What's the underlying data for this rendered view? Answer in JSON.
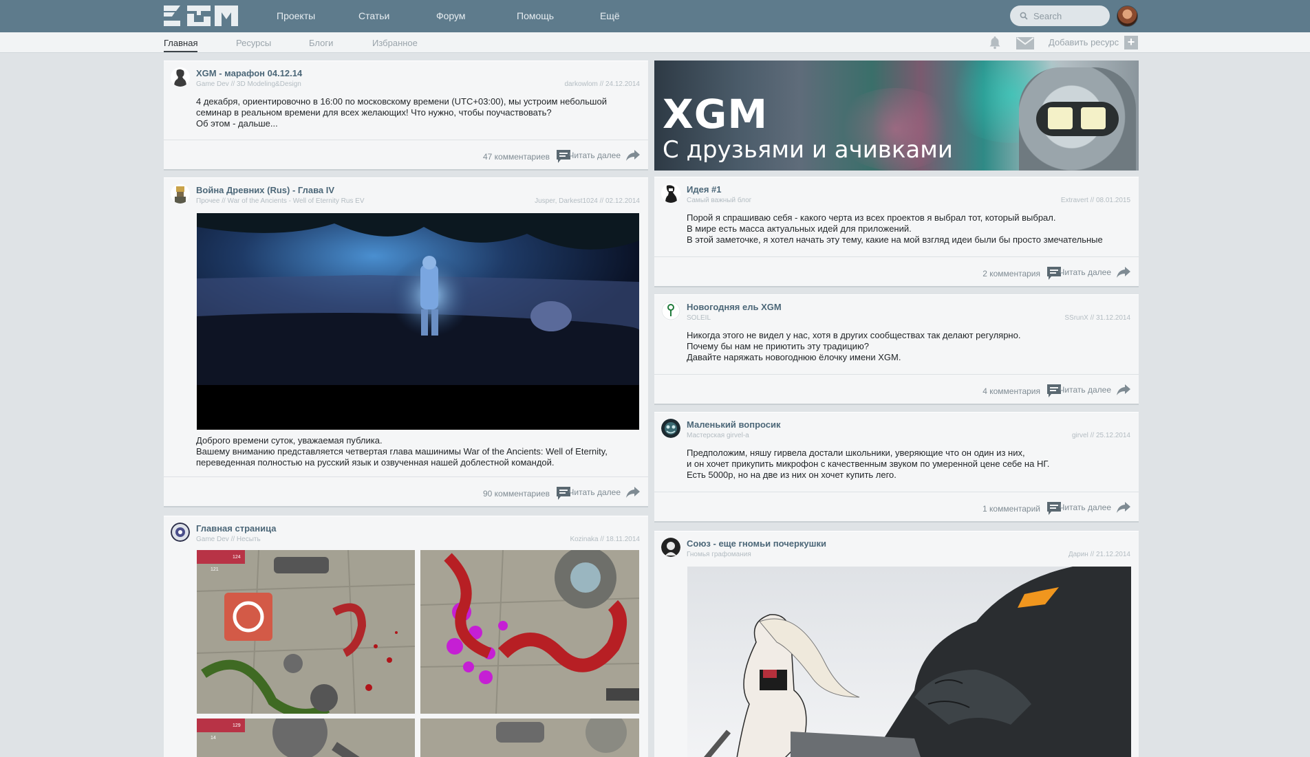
{
  "nav": {
    "items": [
      "Проекты",
      "Статьи",
      "Форум",
      "Помощь",
      "Ещё"
    ],
    "search_placeholder": "Search"
  },
  "subnav": {
    "items": [
      "Главная",
      "Ресурсы",
      "Блоги",
      "Избранное"
    ],
    "active": "Главная",
    "add_resource": "Добавить ресурс"
  },
  "banner": {
    "title": "XGM",
    "subtitle": "С друзьями и ачивками"
  },
  "read_more": "Читать далее",
  "posts_left": [
    {
      "title": "XGM - марафон 04.12.14",
      "meta": "Game Dev // 3D Modeling&Design",
      "by": "darkowlom // 24.12.2014",
      "text": "4 декабря, ориентировочно в 16:00 по московскому времени (UTC+03:00), мы устроим небольшой\nсеминар в реальном времени для всех желающих! Что нужно, чтобы поучаствовать?\nОб этом - дальше...",
      "comments": "47 комментариев"
    },
    {
      "title": "Война Древних (Rus) - Глава IV",
      "meta": "Прочее // War of the Ancients - Well of Eternity Rus EV",
      "by": "Jusper, Darkest1024 // 02.12.2014",
      "text": "Доброго времени суток, уважаемая публика.\nВашему вниманию представляется четвертая глава машинимы War of the Ancients: Well of Eternity,\nпереведенная полностью на русский язык и озвученная нашей доблестной командой.",
      "comments": "90 комментариев"
    },
    {
      "title": "Главная страница",
      "meta": "Game Dev // Несыть",
      "by": "Kozinaka // 18.11.2014"
    }
  ],
  "posts_right": [
    {
      "title": "Идея #1",
      "meta": "Самый важный блог",
      "by": "Extravert // 08.01.2015",
      "text": "Порой я спрашиваю себя - какого черта из всех проектов я выбрал тот, который выбрал.\nВ мире есть масса актуальных идей для приложений.\nВ этой заметочке, я хотел начать эту тему, какие на мой взгляд идеи были бы просто змечательные",
      "comments": "2 комментария"
    },
    {
      "title": "Новогодняя ель XGM",
      "meta": "SOLEIL",
      "by": "SSrunX // 31.12.2014",
      "text": "Никогда этого не видел у нас, хотя в других сообществах так делают регулярно.\nПочему бы нам не приютить эту традицию?\nДавайте наряжать новогоднюю ёлочку имени XGM.",
      "comments": "4 комментария"
    },
    {
      "title": "Маленький вопросик",
      "meta": "Мастерская girvel-a",
      "by": "girvel // 25.12.2014",
      "text": "Предположим, няшу гирвела достали школьники, уверяющие что он один из них,\nи он хочет прикупить микрофон с качественным звуком по умеренной цене себе на НГ.\nЕсть 5000р, но на две из них он хочет купить лего.",
      "comments": "1 комментарий"
    },
    {
      "title": "Союз - еще гномьи почеркушки",
      "meta": "Гномья графомания",
      "by": "Дарин // 21.12.2014"
    }
  ],
  "game_hud": [
    "124",
    "121",
    "129",
    "14"
  ]
}
